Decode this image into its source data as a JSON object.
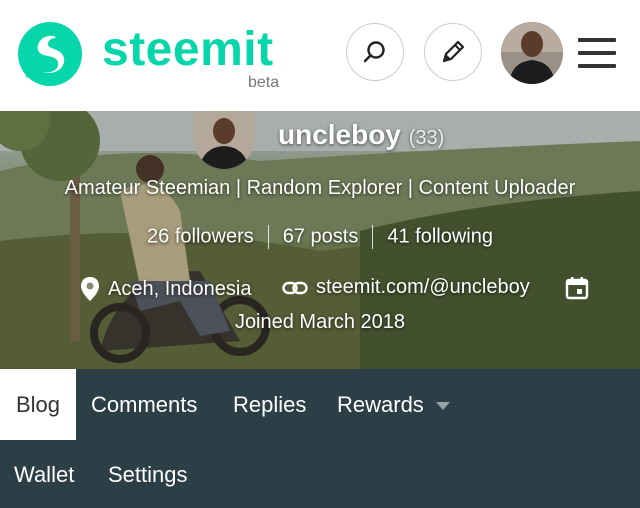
{
  "header": {
    "brand": "steemit",
    "badge": "beta",
    "search_icon": "search-icon",
    "edit_icon": "pencil-icon",
    "menu_icon": "hamburger-icon",
    "accent": "#06d6a9"
  },
  "profile": {
    "username": "uncleboy",
    "reputation": "(33)",
    "about": "Amateur Steemian | Random Explorer | Content Uploader",
    "followers": "26 followers",
    "posts": "67 posts",
    "following": "41 following",
    "location": "Aceh, Indonesia",
    "website": "steemit.com/@uncleboy",
    "joined": "Joined March 2018"
  },
  "tabs": {
    "items": [
      {
        "label": "Blog",
        "active": true
      },
      {
        "label": "Comments"
      },
      {
        "label": "Replies"
      },
      {
        "label": "Rewards"
      },
      {
        "label": "Wallet"
      },
      {
        "label": "Settings"
      }
    ],
    "bg_color": "#2c3e46"
  }
}
